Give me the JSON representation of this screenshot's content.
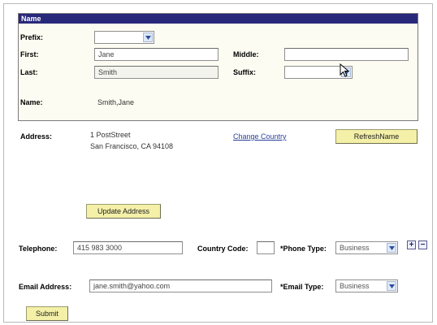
{
  "name_section": {
    "header": "Name",
    "prefix_label": "Prefix:",
    "prefix_value": "",
    "first_label": "First:",
    "first_value": "Jane",
    "middle_label": "Middle:",
    "middle_value": "",
    "last_label": "Last:",
    "last_value": "Smith",
    "suffix_label": "Suffix:",
    "suffix_value": "",
    "name_label": "Name:",
    "name_value": "Smith,Jane"
  },
  "address": {
    "label": "Address:",
    "line1": "1 PostStreet",
    "line2": "San Francisco, CA 94108",
    "change_country_link": "Change Country",
    "refresh_name_button": "RefreshName",
    "update_address_button": "Update Address"
  },
  "phone": {
    "label": "Telephone:",
    "value": "415 983 3000",
    "country_code_label": "Country Code:",
    "country_code_value": "",
    "phone_type_label": "*Phone Type:",
    "phone_type_value": "Business",
    "add_symbol": "+",
    "remove_symbol": "−"
  },
  "email": {
    "label": "Email Address:",
    "value": "jane.smith@yahoo.com",
    "email_type_label": "*Email Type:",
    "email_type_value": "Business"
  },
  "submit_button": "Submit",
  "icons": {
    "dropdown": "chevron-down-icon",
    "cursor": "mouse-pointer-icon"
  },
  "colors": {
    "header_bg": "#28287a",
    "button_bg": "#f4f0a8",
    "link": "#2a3f9a"
  }
}
